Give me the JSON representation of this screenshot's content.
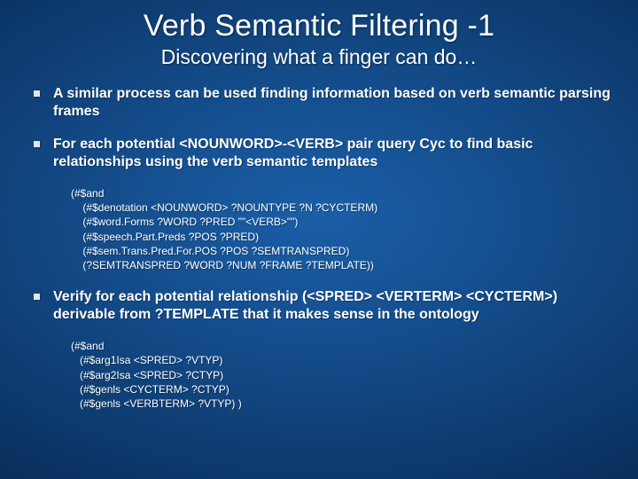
{
  "title": "Verb Semantic Filtering -1",
  "subtitle": "Discovering what a finger can do…",
  "bullets": {
    "b0": "A similar process can be used finding information based on verb semantic parsing frames",
    "b1": "For each potential <NOUNWORD>-<VERB> pair query Cyc to find basic relationships using the verb semantic templates",
    "b2": "Verify for each potential relationship (<SPRED> <VERTERM> <CYCTERM>) derivable from ?TEMPLATE that it makes sense in the ontology"
  },
  "code": {
    "c0": "(#$and\n    (#$denotation <NOUNWORD> ?NOUNTYPE ?N ?CYCTERM)\n    (#$word.Forms ?WORD ?PRED \"\"<VERB>\"\")\n    (#$speech.Part.Preds ?POS ?PRED)\n    (#$sem.Trans.Pred.For.POS ?POS ?SEMTRANSPRED)\n    (?SEMTRANSPRED ?WORD ?NUM ?FRAME ?TEMPLATE))",
    "c1": "(#$and\n   (#$arg1Isa <SPRED> ?VTYP)\n   (#$arg2Isa <SPRED> ?CTYP)\n   (#$genls <CYCTERM> ?CTYP)\n   (#$genls <VERBTERM> ?VTYP) )"
  }
}
